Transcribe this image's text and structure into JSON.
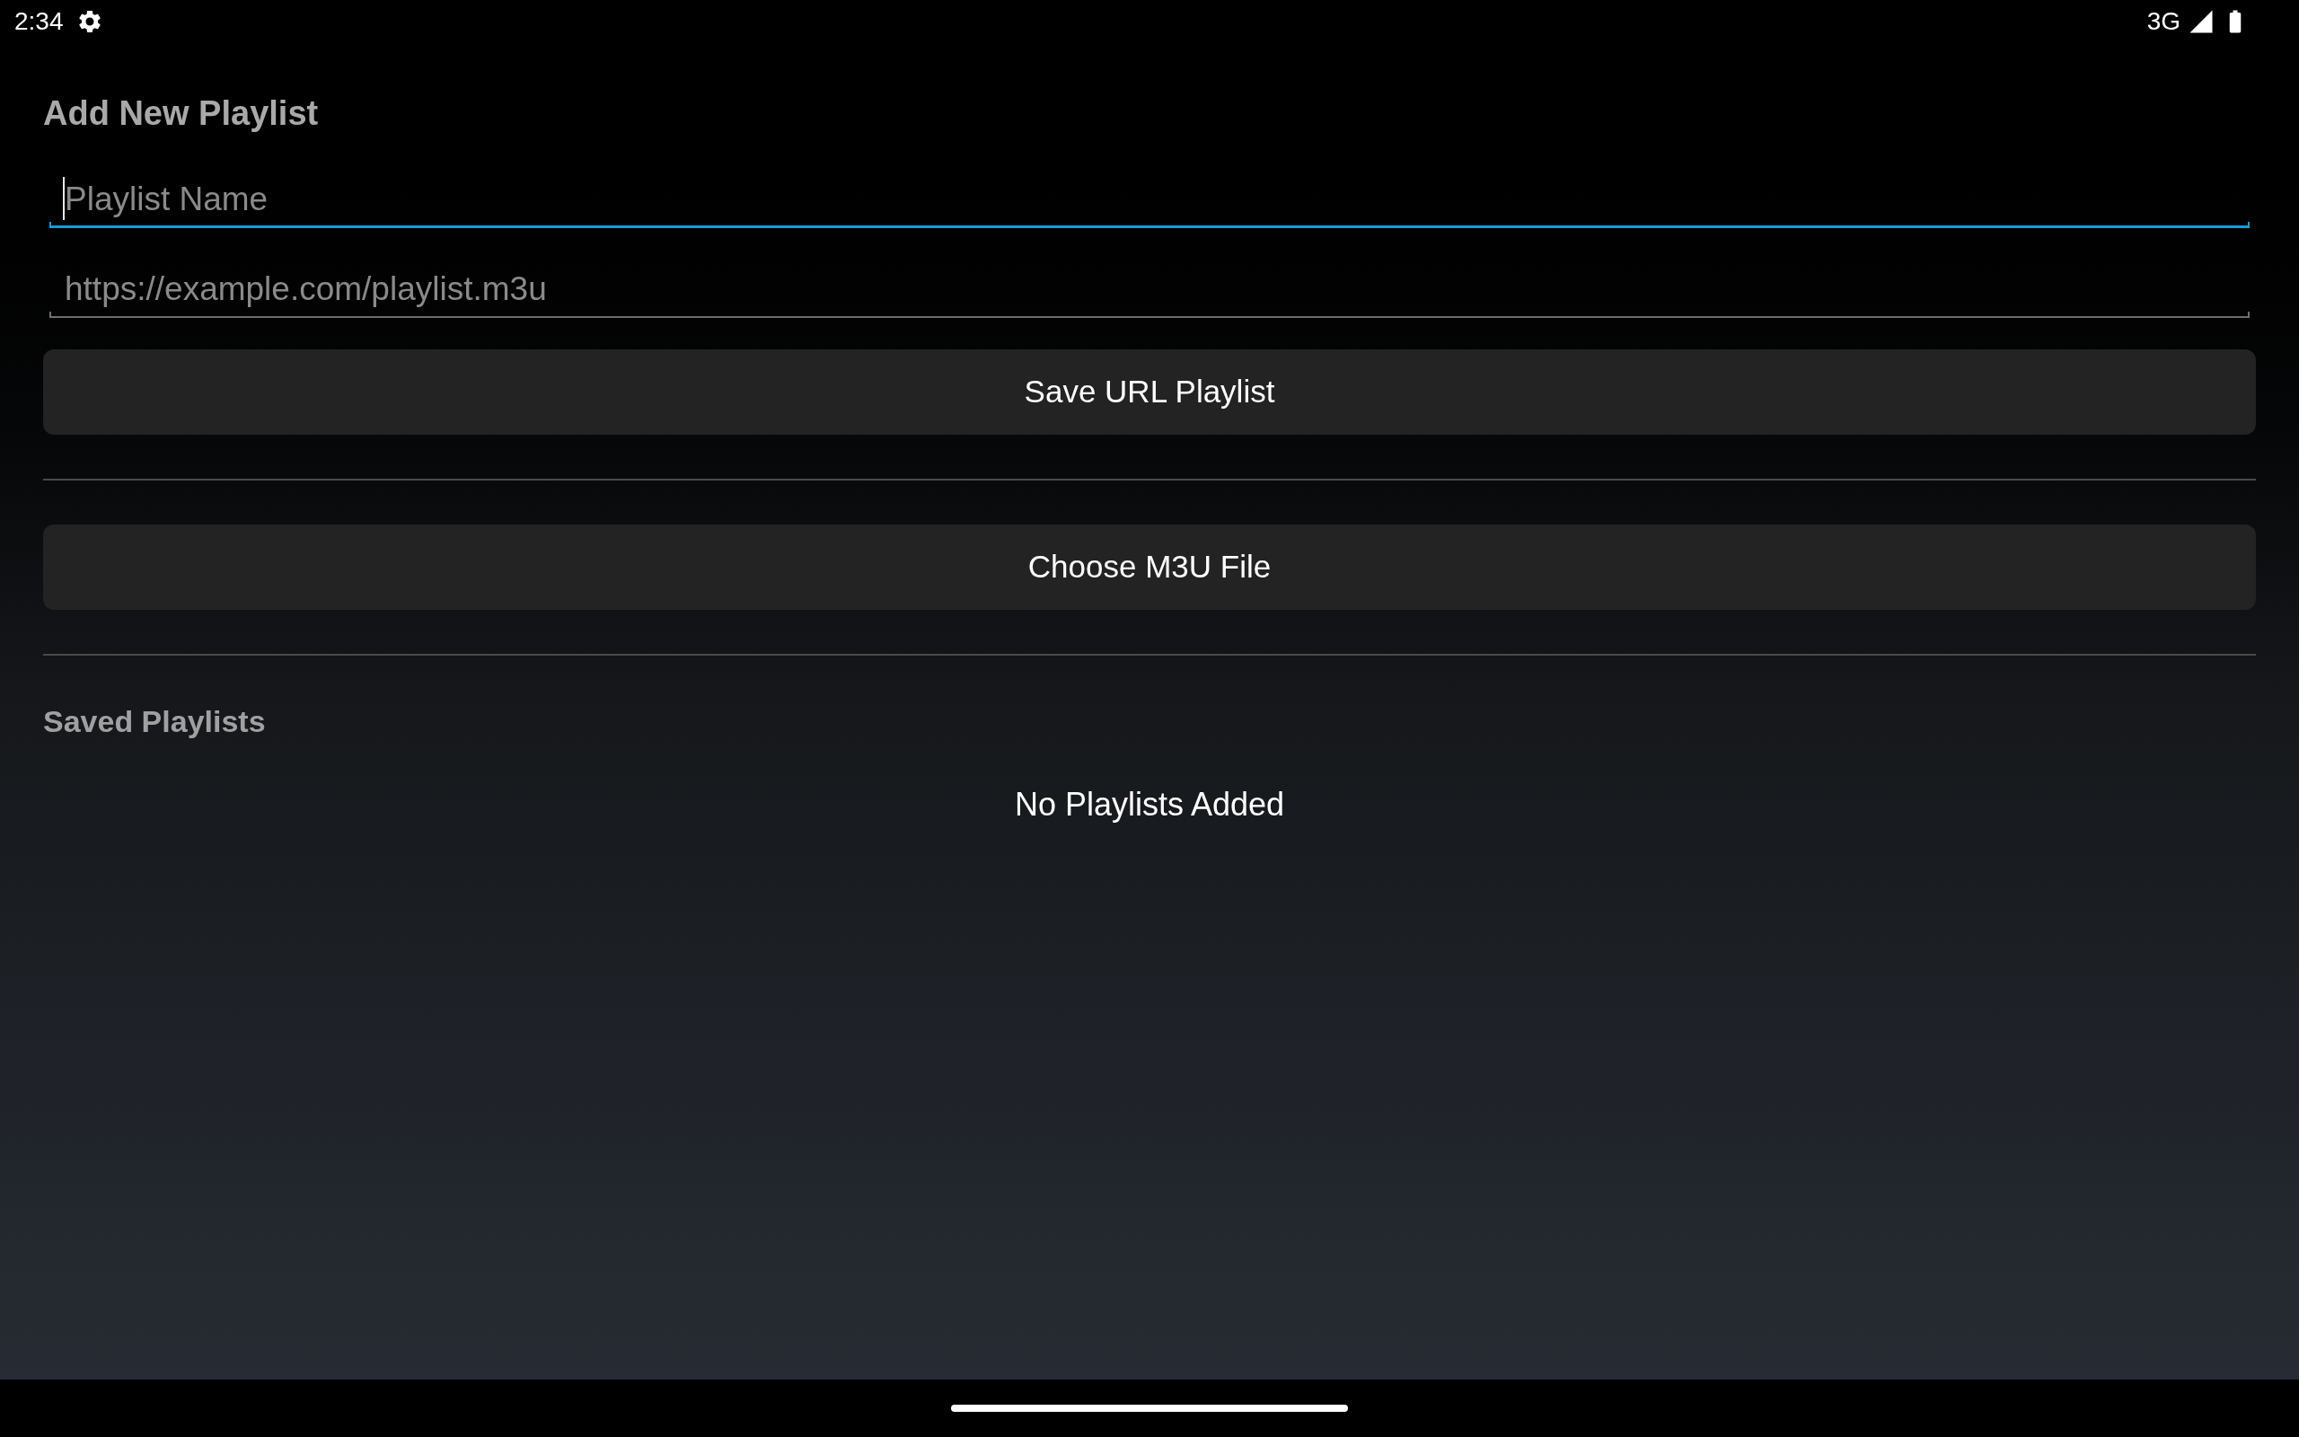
{
  "status_bar": {
    "time": "2:34",
    "network": "3G"
  },
  "title": "Add New Playlist",
  "url_form": {
    "fields": [
      {
        "placeholder": "Playlist Name",
        "focused": true
      },
      {
        "placeholder": "https://example.com/playlist.m3u",
        "focused": false
      }
    ],
    "save_button": "Save URL Playlist"
  },
  "file_button": "Choose M3U File",
  "saved_playlists": {
    "title": "Saved Playlists",
    "empty_message": "No Playlists Added"
  }
}
